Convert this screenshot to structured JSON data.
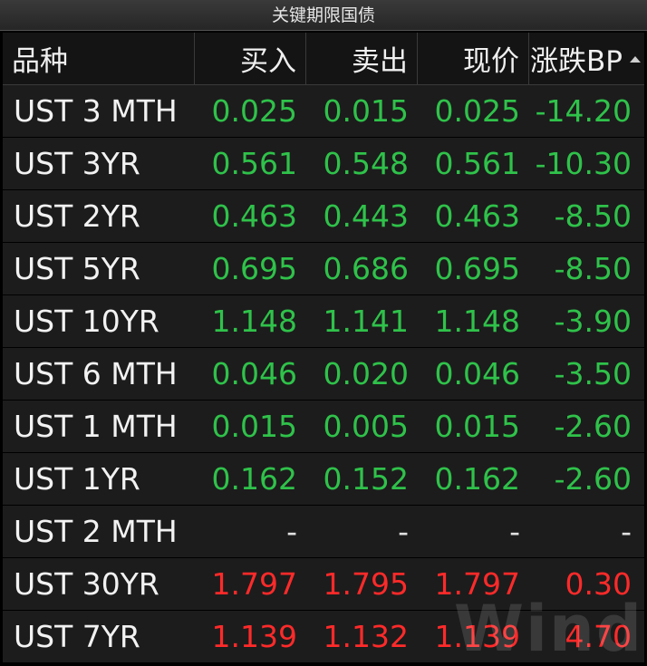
{
  "window": {
    "title": "关键期限国债"
  },
  "table": {
    "columns": [
      "品种",
      "买入",
      "卖出",
      "现价",
      "涨跌BP"
    ],
    "rows": [
      {
        "name": "UST 3 MTH",
        "bid": "0.025",
        "ask": "0.015",
        "last": "0.025",
        "chg": "-14.20",
        "tone": "green"
      },
      {
        "name": "UST 3YR",
        "bid": "0.561",
        "ask": "0.548",
        "last": "0.561",
        "chg": "-10.30",
        "tone": "green"
      },
      {
        "name": "UST 2YR",
        "bid": "0.463",
        "ask": "0.443",
        "last": "0.463",
        "chg": "-8.50",
        "tone": "green"
      },
      {
        "name": "UST 5YR",
        "bid": "0.695",
        "ask": "0.686",
        "last": "0.695",
        "chg": "-8.50",
        "tone": "green"
      },
      {
        "name": "UST 10YR",
        "bid": "1.148",
        "ask": "1.141",
        "last": "1.148",
        "chg": "-3.90",
        "tone": "green"
      },
      {
        "name": "UST 6 MTH",
        "bid": "0.046",
        "ask": "0.020",
        "last": "0.046",
        "chg": "-3.50",
        "tone": "green"
      },
      {
        "name": "UST 1 MTH",
        "bid": "0.015",
        "ask": "0.005",
        "last": "0.015",
        "chg": "-2.60",
        "tone": "green"
      },
      {
        "name": "UST 1YR",
        "bid": "0.162",
        "ask": "0.152",
        "last": "0.162",
        "chg": "-2.60",
        "tone": "green"
      },
      {
        "name": "UST 2 MTH",
        "bid": "-",
        "ask": "-",
        "last": "-",
        "chg": "-",
        "tone": "neutral"
      },
      {
        "name": "UST 30YR",
        "bid": "1.797",
        "ask": "1.795",
        "last": "1.797",
        "chg": "0.30",
        "tone": "red"
      },
      {
        "name": "UST 7YR",
        "bid": "1.139",
        "ask": "1.132",
        "last": "1.139",
        "chg": "4.70",
        "tone": "red"
      }
    ]
  },
  "sort": {
    "icon": "sort-ascending-icon"
  },
  "watermark": "Wind",
  "colors": {
    "up": "#ff2a2a",
    "down": "#2fc24a",
    "neutral": "#e0e0e0",
    "background": "#000000",
    "row": "#1c1c1c"
  }
}
